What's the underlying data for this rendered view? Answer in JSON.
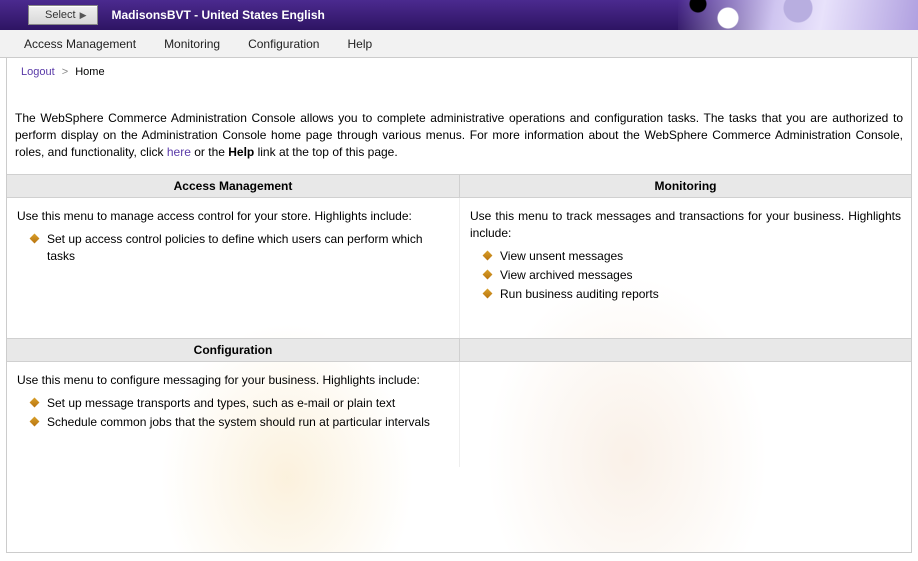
{
  "header": {
    "select_label": "Select",
    "site_title": "MadisonsBVT - United States English"
  },
  "menu": {
    "items": [
      "Access Management",
      "Monitoring",
      "Configuration",
      "Help"
    ]
  },
  "breadcrumb": {
    "logout": "Logout",
    "sep": ">",
    "current": "Home"
  },
  "intro": {
    "part1": "The WebSphere Commerce Administration Console allows you to complete administrative operations and configuration tasks. The tasks that you are authorized to perform display on the Administration Console home page through various menus. For more information about the WebSphere Commerce Administration Console, roles, and functionality, click ",
    "here": "here",
    "part2": " or the ",
    "help_word": "Help",
    "part3": " link at the top of this page."
  },
  "panels": {
    "access": {
      "title": "Access Management",
      "desc": "Use this menu to manage access control for your store. Highlights include:",
      "bullets": [
        "Set up access control policies to define which users can perform which tasks"
      ]
    },
    "monitoring": {
      "title": "Monitoring",
      "desc": "Use this menu to track messages and transactions for your business. Highlights include:",
      "bullets": [
        "View unsent messages",
        "View archived messages",
        "Run business auditing reports"
      ]
    },
    "config": {
      "title": "Configuration",
      "desc": "Use this menu to configure messaging for your business. Highlights include:",
      "bullets": [
        "Set up message transports and types, such as e-mail or plain text",
        "Schedule common jobs that the system should run at particular intervals"
      ]
    }
  }
}
